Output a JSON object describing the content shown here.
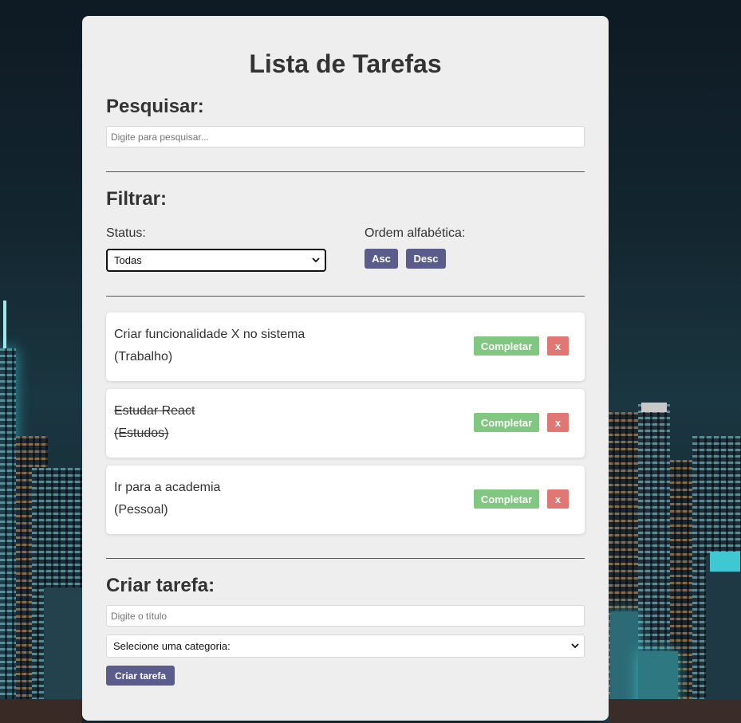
{
  "app": {
    "title": "Lista de Tarefas"
  },
  "search": {
    "heading": "Pesquisar:",
    "placeholder": "Digite para pesquisar..."
  },
  "filter": {
    "heading": "Filtrar:",
    "status_label": "Status:",
    "status_selected": "Todas",
    "order_label": "Ordem alfabética:",
    "asc_label": "Asc",
    "desc_label": "Desc"
  },
  "tasks": [
    {
      "title": "Criar funcionalidade X no sistema",
      "category": "(Trabalho)",
      "completed": false,
      "complete_label": "Completar",
      "remove_label": "x"
    },
    {
      "title": "Estudar React",
      "category": "(Estudos)",
      "completed": true,
      "complete_label": "Completar",
      "remove_label": "x"
    },
    {
      "title": "Ir para a academia",
      "category": "(Pessoal)",
      "completed": false,
      "complete_label": "Completar",
      "remove_label": "x"
    }
  ],
  "create": {
    "heading": "Criar tarefa:",
    "title_placeholder": "Digite o título",
    "category_selected": "Selecione uma categoria:",
    "submit_label": "Criar tarefa"
  },
  "colors": {
    "card_bg": "#eeeeee",
    "primary_button": "#5a5c8c",
    "complete_button": "#80c77f",
    "remove_button": "#e07773"
  },
  "icons": {
    "select_arrow": "chevron-down-icon"
  }
}
